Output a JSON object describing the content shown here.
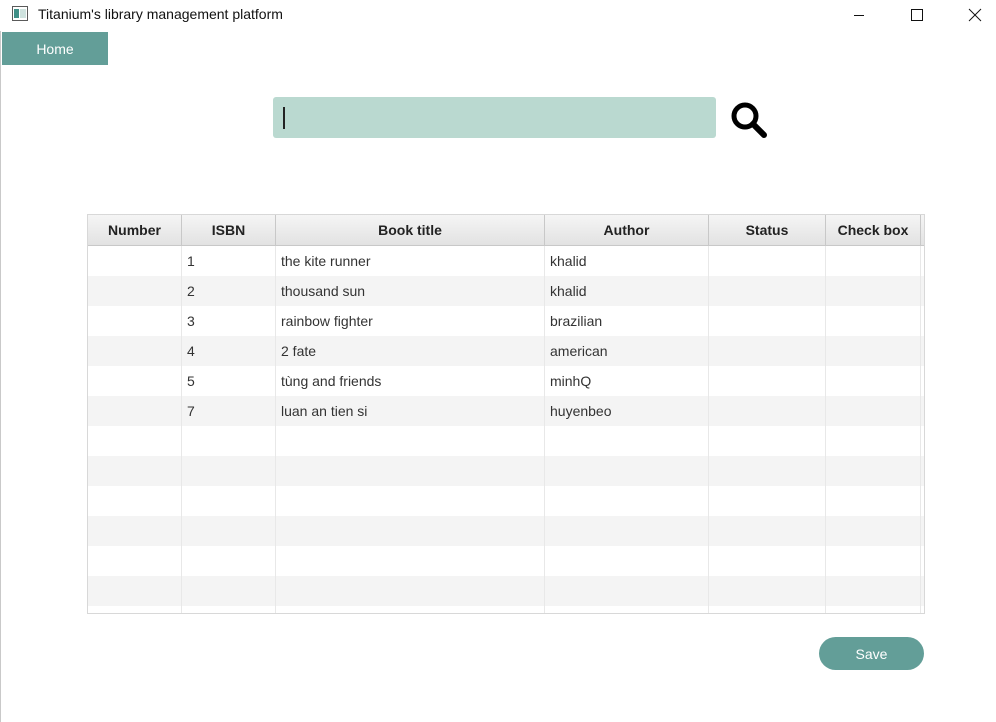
{
  "window": {
    "title": "Titanium's library management platform"
  },
  "nav": {
    "home_label": "Home"
  },
  "search": {
    "value": "",
    "placeholder": ""
  },
  "table": {
    "columns": [
      "Number",
      "ISBN",
      "Book title",
      "Author",
      "Status",
      "Check box"
    ],
    "rows": [
      [
        "",
        "1",
        "the kite runner",
        "khalid",
        "",
        ""
      ],
      [
        "",
        "2",
        "thousand sun",
        "khalid",
        "",
        ""
      ],
      [
        "",
        "3",
        "rainbow fighter",
        "brazilian",
        "",
        ""
      ],
      [
        "",
        "4",
        "2 fate",
        "american",
        "",
        ""
      ],
      [
        "",
        "5",
        "tùng and friends",
        "minhQ",
        "",
        ""
      ],
      [
        "",
        "7",
        "luan an tien si",
        "huyenbeo",
        "",
        ""
      ],
      [
        "",
        "",
        "",
        "",
        "",
        ""
      ],
      [
        "",
        "",
        "",
        "",
        "",
        ""
      ],
      [
        "",
        "",
        "",
        "",
        "",
        ""
      ],
      [
        "",
        "",
        "",
        "",
        "",
        ""
      ],
      [
        "",
        "",
        "",
        "",
        "",
        ""
      ],
      [
        "",
        "",
        "",
        "",
        "",
        ""
      ],
      [
        "",
        "",
        "",
        "",
        "",
        ""
      ]
    ]
  },
  "actions": {
    "save_label": "Save"
  },
  "colors": {
    "accent": "#639e98",
    "search_bg": "#bad9d0"
  }
}
